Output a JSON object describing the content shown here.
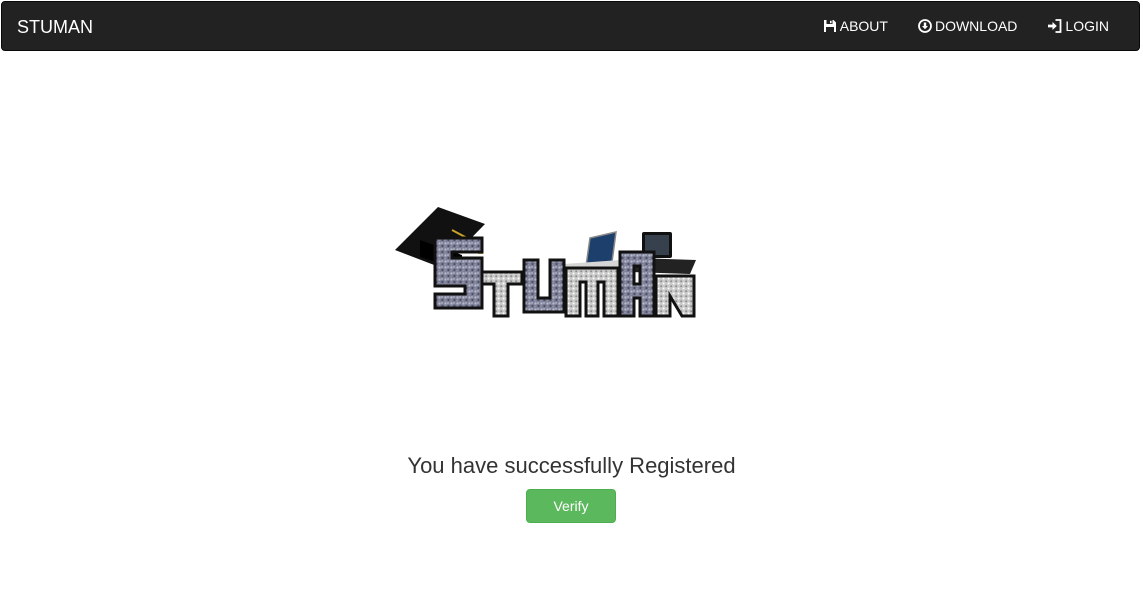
{
  "navbar": {
    "brand": "STUMAN",
    "items": [
      {
        "label": "ABOUT",
        "icon": "floppy-disk-icon"
      },
      {
        "label": "DOWNLOAD",
        "icon": "download-circle-icon"
      },
      {
        "label": "LOGIN",
        "icon": "login-icon"
      }
    ]
  },
  "logo": {
    "text": "STUMAN"
  },
  "main": {
    "message": "You have successfully Registered",
    "verify_label": "Verify"
  },
  "colors": {
    "navbar_bg": "#222222",
    "button_green": "#5cb85c",
    "text": "#333333"
  }
}
